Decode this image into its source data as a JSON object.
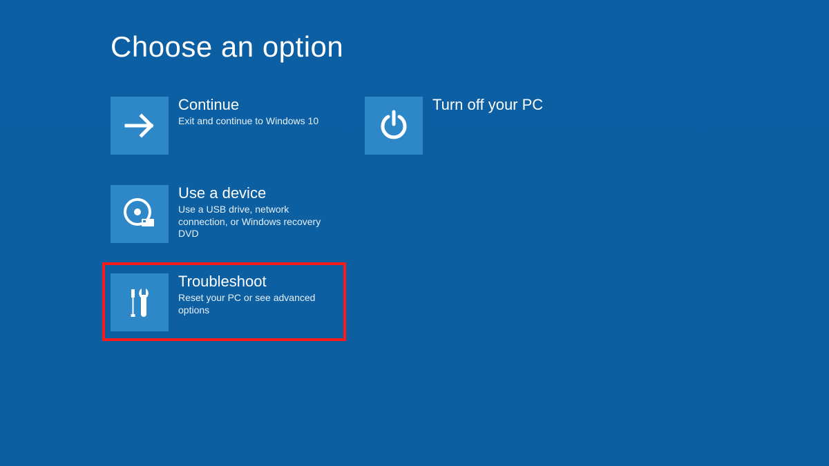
{
  "heading": "Choose an option",
  "options": {
    "continue": {
      "title": "Continue",
      "sub": "Exit and continue to Windows 10"
    },
    "device": {
      "title": "Use a device",
      "sub": "Use a USB drive, network connection, or Windows recovery DVD"
    },
    "troubleshoot": {
      "title": "Troubleshoot",
      "sub": "Reset your PC or see advanced options"
    },
    "poweroff": {
      "title": "Turn off your PC",
      "sub": ""
    }
  },
  "highlighted_option": "troubleshoot",
  "colors": {
    "background": "#0a5fa3",
    "tile": "#2e88c8",
    "highlight": "#ff1a1a"
  }
}
